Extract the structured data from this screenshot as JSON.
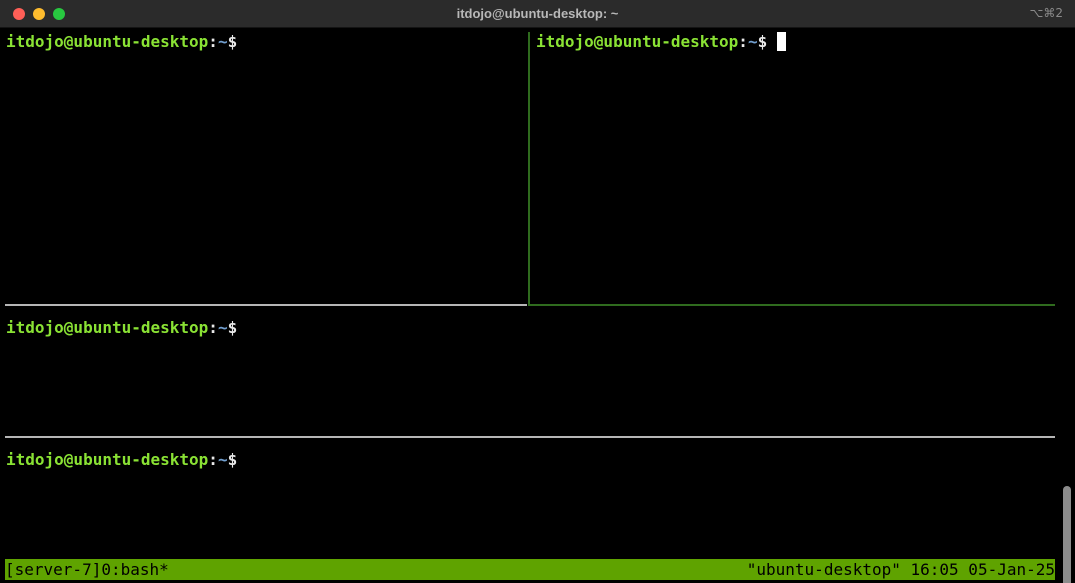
{
  "window": {
    "title": "itdojo@ubuntu-desktop: ~",
    "shortcut": "⌥⌘2"
  },
  "prompt": {
    "user_host": "itdojo@ubuntu-desktop",
    "colon": ":",
    "path": "~",
    "dollar": "$"
  },
  "panes": [
    {
      "name": "pane-top-left",
      "active": false
    },
    {
      "name": "pane-top-right",
      "active": true
    },
    {
      "name": "pane-middle",
      "active": false
    },
    {
      "name": "pane-bottom",
      "active": false
    }
  ],
  "status_bar": {
    "left": "[server-7]0:bash*",
    "right": "\"ubuntu-desktop\" 16:05 05-Jan-25"
  },
  "colors": {
    "prompt_user": "#8ae234",
    "prompt_path": "#729fcf",
    "status_bg": "#5fa300",
    "active_border": "#2f6b1e",
    "inactive_border": "#b5b5b5"
  }
}
